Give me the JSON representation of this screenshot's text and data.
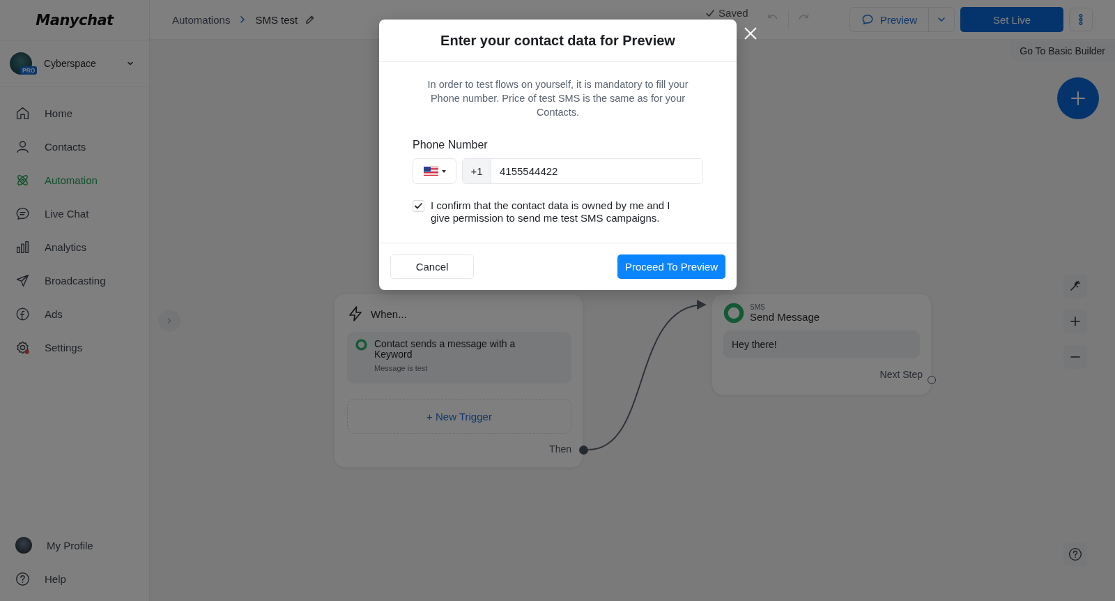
{
  "sidebar": {
    "logo": "Manychat",
    "workspace": {
      "name": "Cyberspace",
      "badge": "PRO"
    },
    "items": [
      {
        "label": "Home",
        "selected": false
      },
      {
        "label": "Contacts",
        "selected": false
      },
      {
        "label": "Automation",
        "selected": true
      },
      {
        "label": "Live Chat",
        "selected": false
      },
      {
        "label": "Analytics",
        "selected": false
      },
      {
        "label": "Broadcasting",
        "selected": false
      },
      {
        "label": "Ads",
        "selected": false
      },
      {
        "label": "Settings",
        "selected": false
      }
    ],
    "footer_items": [
      {
        "label": "My Profile",
        "kind": "avatar"
      },
      {
        "label": "Help",
        "kind": "help"
      }
    ]
  },
  "topbar": {
    "breadcrumb": [
      "Automations",
      "SMS test"
    ],
    "status": "Saved",
    "preview_button": "Preview",
    "set_live_button": "Set Live"
  },
  "canvas": {
    "basic_builder_link": "Go To Basic Builder",
    "trigger_node": {
      "title": "When...",
      "trigger": {
        "title": "Contact sends a message with a Keyword",
        "detail": "Message is test"
      },
      "add_button": "+ New Trigger",
      "output_label": "Then"
    },
    "message_node": {
      "channel": "SMS",
      "title": "Send Message",
      "message": "Hey there!",
      "output_label": "Next Step"
    }
  },
  "modal": {
    "title": "Enter your contact data for Preview",
    "description": "In order to test flows on yourself, it is mandatory to fill your Phone number. Price of test SMS is the same as for your Contacts.",
    "phone_label": "Phone Number",
    "country_code": "+1",
    "phone_value": "4155544422",
    "consent": {
      "text": "I confirm that the contact data is owned by me and I give permission to send me test SMS campaigns.",
      "checked": true
    },
    "cancel_button": "Cancel",
    "confirm_button": "Proceed To Preview"
  }
}
